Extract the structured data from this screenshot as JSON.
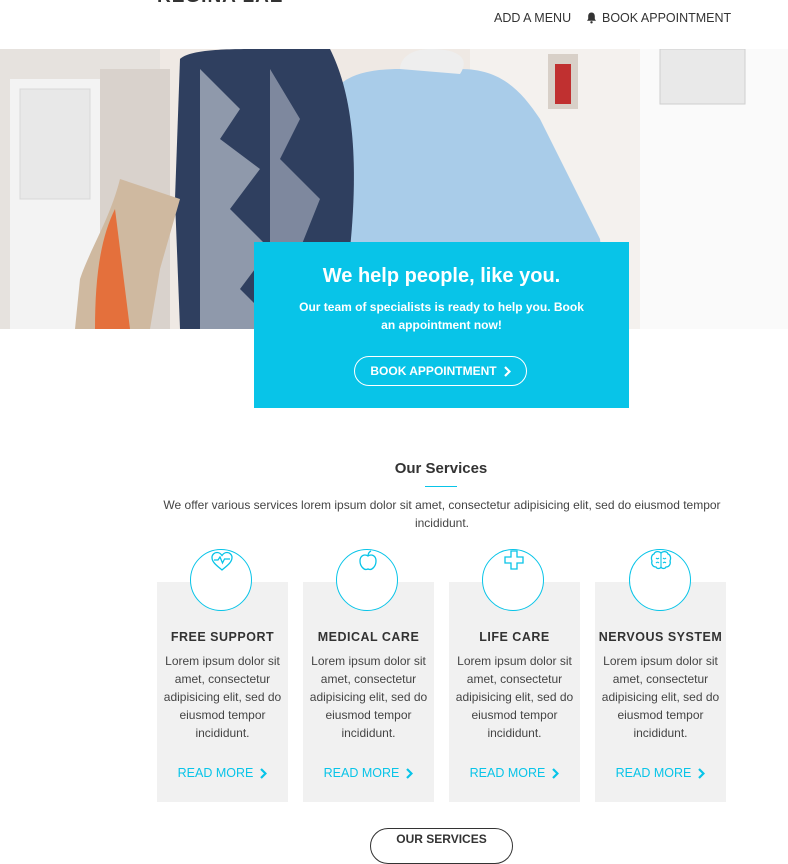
{
  "header": {
    "logo": "REGINA LAE",
    "nav_add_menu": "ADD A MENU",
    "nav_book": "BOOK APPOINTMENT"
  },
  "hero": {
    "title": "We help people, like you.",
    "text": "Our team of specialists is ready to help you. Book an appointment now!",
    "button": "BOOK APPOINTMENT"
  },
  "services": {
    "title": "Our Services",
    "intro": "We offer various services lorem ipsum dolor sit amet, consectetur adipisicing elit, sed do eiusmod tempor incididunt.",
    "items": [
      {
        "icon": "heart-pulse-icon",
        "title": "FREE SUPPORT",
        "text": "Lorem ipsum dolor sit amet, consectetur adipisicing elit, sed do eiusmod tempor incididunt.",
        "link": "READ MORE"
      },
      {
        "icon": "apple-icon",
        "title": "MEDICAL CARE",
        "text": "Lorem ipsum dolor sit amet, consectetur adipisicing elit, sed do eiusmod tempor incididunt.",
        "link": "READ MORE"
      },
      {
        "icon": "medical-cross-icon",
        "title": "LIFE CARE",
        "text": "Lorem ipsum dolor sit amet, consectetur adipisicing elit, sed do eiusmod tempor incididunt.",
        "link": "READ MORE"
      },
      {
        "icon": "brain-icon",
        "title": "NERVOUS SYSTEM",
        "text": "Lorem ipsum dolor sit amet, consectetur adipisicing elit, sed do eiusmod tempor incididunt.",
        "link": "READ MORE"
      }
    ],
    "all_button": "OUR SERVICES"
  },
  "colors": {
    "accent": "#08c4e8",
    "card_bg": "#f1f1f1"
  }
}
